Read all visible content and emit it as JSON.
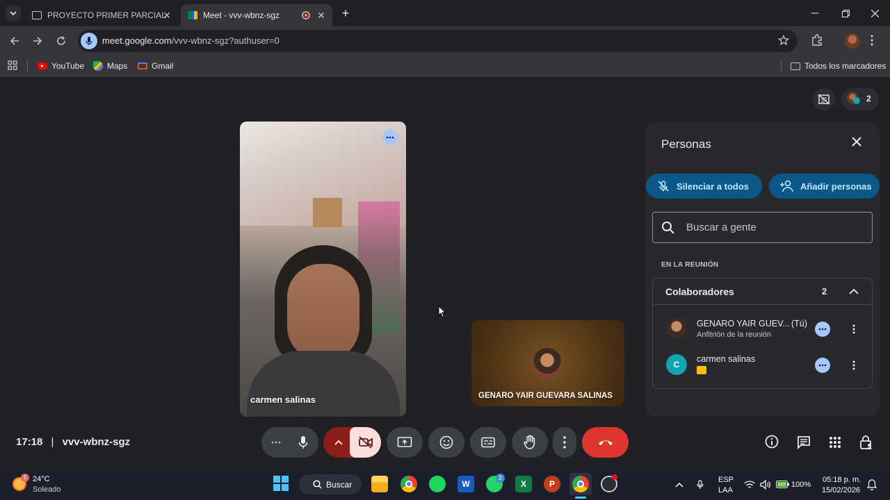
{
  "browser": {
    "tabs": [
      {
        "title": "PROYECTO PRIMER PARCIAL",
        "active": false
      },
      {
        "title": "Meet - vvv-wbnz-sgz",
        "active": true
      }
    ],
    "url_host": "meet.google.com",
    "url_path": "/vvv-wbnz-sgz?authuser=0",
    "bookmarks": [
      "YouTube",
      "Maps",
      "Gmail"
    ],
    "all_bookmarks_label": "Todos los marcadores"
  },
  "meet": {
    "participant_count": "2",
    "tiles": {
      "carmen_name": "carmen salinas",
      "genaro_name": "GENARO YAIR GUEVARA SALINAS"
    },
    "footer": {
      "time": "17:18",
      "separator": "|",
      "meeting_code": "vvv-wbnz-sgz"
    }
  },
  "panel": {
    "title": "Personas",
    "mute_all_label": "Silenciar a todos",
    "add_people_label": "Añadir personas",
    "search_placeholder": "Buscar a gente",
    "section_label": "EN LA REUNIÓN",
    "group_name": "Colaboradores",
    "group_count": "2",
    "people": [
      {
        "name": "GENARO YAIR GUEV...",
        "tag": "(Tú)",
        "subtitle": "Anfitrión de la reunión"
      },
      {
        "name": "carmen salinas",
        "initial": "C"
      }
    ]
  },
  "taskbar": {
    "weather_temp": "24°C",
    "weather_desc": "Soleado",
    "weather_badge": "1",
    "search_label": "Buscar",
    "whatsapp_badge": "2",
    "lang_top": "ESP",
    "lang_bottom": "LAA",
    "battery": "100%",
    "clock_time": "05:18 p. m.",
    "clock_date": "15/02/2026"
  },
  "colors": {
    "accent_pill": "#0b5787",
    "end_call": "#dc362e",
    "camera_off_bg": "#f9dedc",
    "camera_group": "#8c1d18"
  }
}
